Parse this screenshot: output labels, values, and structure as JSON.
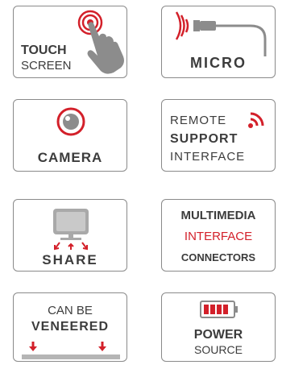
{
  "tiles": {
    "touch": {
      "line1": "TOUCH",
      "line2": "SCREEN",
      "icon": "touch-hand-icon"
    },
    "micro": {
      "label": "MICRO",
      "icon": "microphone-icon"
    },
    "camera": {
      "label": "CAMERA",
      "icon": "camera-lens-icon"
    },
    "remote": {
      "line1": "REMOTE",
      "line2": "SUPPORT",
      "line3": "INTERFACE",
      "icon": "wifi-signal-icon"
    },
    "share": {
      "label": "SHARE",
      "icon": "screen-share-icon"
    },
    "multimedia": {
      "line1": "MULTIMEDIA",
      "line2": "INTERFACE",
      "line3": "CONNECTORS"
    },
    "veneered": {
      "line1": "CAN BE",
      "line2": "VENEERED",
      "icon": "veneer-arrows-icon"
    },
    "power": {
      "line1": "POWER",
      "line2": "SOURCE",
      "icon": "battery-icon"
    }
  },
  "colors": {
    "accent": "#d3202a",
    "text": "#3c3c3c",
    "icon_gray": "#8c8c8c",
    "border": "#8a8a8a"
  }
}
